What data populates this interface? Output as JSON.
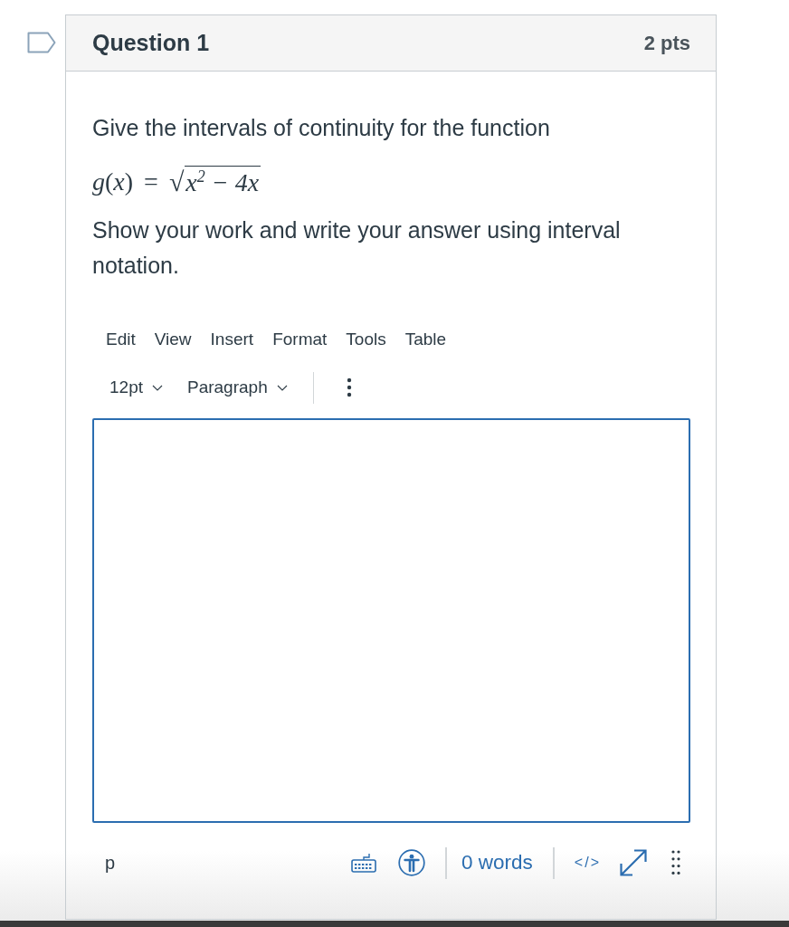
{
  "question": {
    "flagged": false,
    "title": "Question 1",
    "points": "2 pts"
  },
  "prompt": [
    {
      "kind": "paragraph",
      "text": "Give the intervals of continuity for the function"
    },
    {
      "kind": "math",
      "lhs": "*g*(*x*)",
      "relation": "=",
      "root_sign": "√",
      "radicand": "x$^{2}$ − 4x"
    },
    {
      "kind": "paragraph",
      "text": "Show your work and write your answer using interval notation."
    }
  ],
  "editor": {
    "menubar": [
      "Edit",
      "View",
      "Insert",
      "Format",
      "Tools",
      "Table"
    ],
    "toolbar": {
      "font_size": "12pt",
      "block_format": "Paragraph"
    },
    "focused": true
  },
  "status_bar": {
    "element_path": "p",
    "word_count": "0 words",
    "html_toggle": "</>"
  }
}
